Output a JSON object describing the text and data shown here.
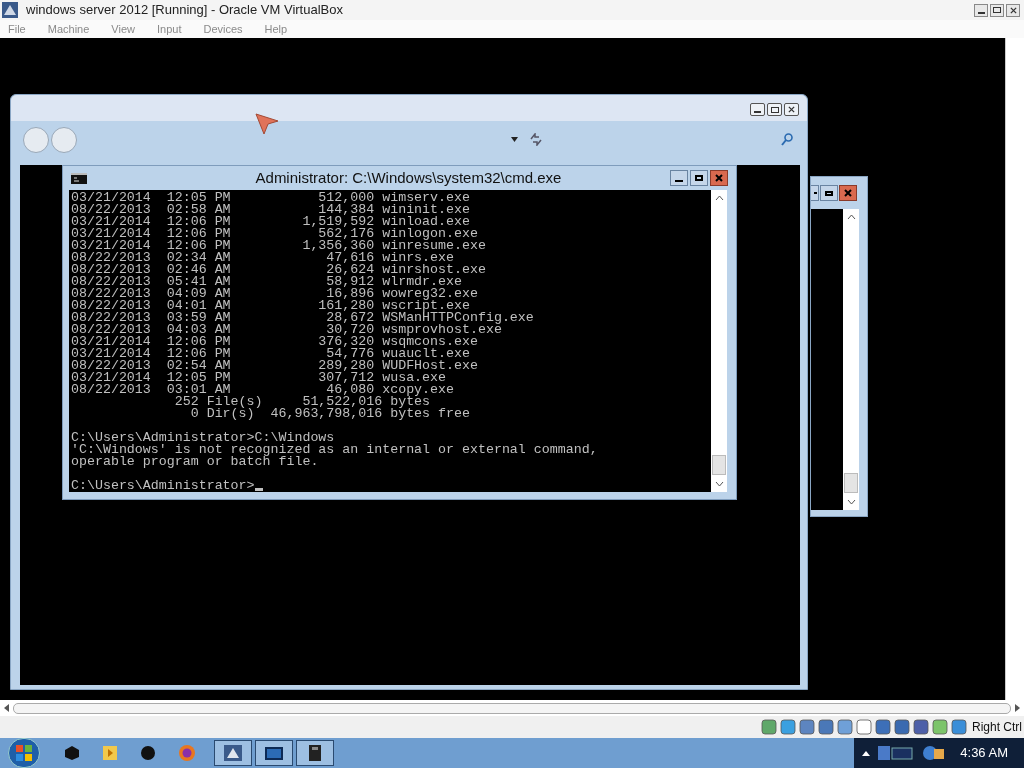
{
  "window": {
    "title": "windows server 2012 [Running] - Oracle VM VirtualBox"
  },
  "menu": [
    "File",
    "Machine",
    "View",
    "Input",
    "Devices",
    "Help"
  ],
  "console": {
    "title": "Administrator: C:\\Windows\\system32\\cmd.exe",
    "blocks": [
      [
        "03/21/2014  12:05 PM           512,000 wimserv.exe",
        "08/22/2013  02:58 AM           144,384 wininit.exe",
        "03/21/2014  12:06 PM         1,519,592 winload.exe",
        "03/21/2014  12:06 PM           562,176 winlogon.exe",
        "03/21/2014  12:06 PM         1,356,360 winresume.exe",
        "08/22/2013  02:34 AM            47,616 winrs.exe",
        "08/22/2013  02:46 AM            26,624 winrshost.exe",
        "08/22/2013  05:41 AM            58,912 wlrmdr.exe",
        "08/22/2013  04:09 AM            16,896 wowreg32.exe",
        "08/22/2013  04:01 AM           161,280 wscript.exe",
        "08/22/2013  03:59 AM            28,672 WSManHTTPConfig.exe",
        "08/22/2013  04:03 AM            30,720 wsmprovhost.exe",
        "03/21/2014  12:06 PM           376,320 wsqmcons.exe",
        "03/21/2014  12:06 PM            54,776 wuauclt.exe",
        "08/22/2013  02:54 AM           289,280 WUDFHost.exe",
        "03/21/2014  12:05 PM           307,712 wusa.exe",
        "08/22/2013  03:01 AM            46,080 xcopy.exe",
        "             252 File(s)     51,522,016 bytes",
        "               0 Dir(s)  46,963,798,016 bytes free"
      ],
      [
        "C:\\Users\\Administrator>C:\\Windows",
        "'C:\\Windows' is not recognized as an internal or external command,",
        "operable program or batch file."
      ],
      [
        "C:\\Users\\Administrator>"
      ]
    ]
  },
  "status_bar": {
    "host_key": "Right Ctrl"
  },
  "clock": "4:36 AM"
}
